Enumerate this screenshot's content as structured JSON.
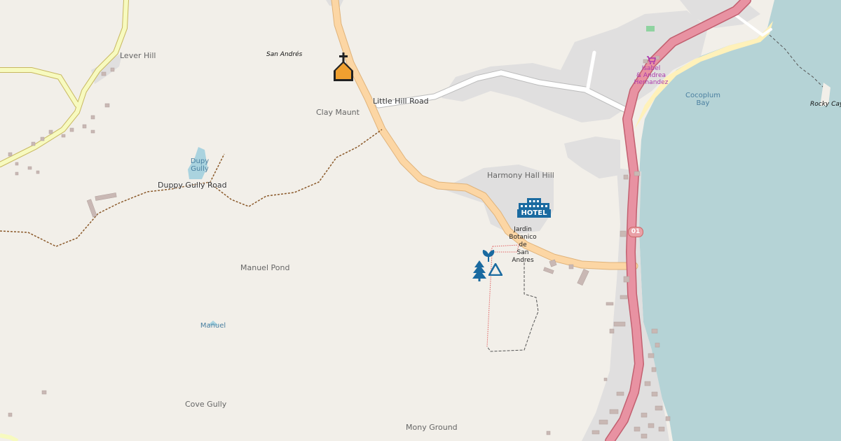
{
  "colors": {
    "land": "#f2efe9",
    "sea": "#aad3df",
    "sea_bay": "#b5d0d0",
    "residential": "#e0dfdf",
    "primary_road": "#e892a2",
    "secondary_road": "#fcd6a4",
    "tertiary_road": "#f7fabf",
    "minor_road": "#ffffff",
    "path": "#8b5a2b",
    "building": "#c9b8b4",
    "beach": "#fff1ba",
    "poi_blue": "#1a6aa0",
    "church": "#f0a030"
  },
  "places": {
    "lever_hill": "Lever Hill",
    "san_andres": "San Andrés",
    "clay_maunt": "Clay Maunt",
    "harmony_hall_hill": "Harmony Hall Hill",
    "manuel_pond": "Manuel Pond",
    "cove_gully": "Cove Gully",
    "mony_ground": "Mony Ground",
    "rocky_cay": "Rocky Cay"
  },
  "water": {
    "dupy_gully_1": "Dupy",
    "dupy_gully_2": "Gully",
    "manuel": "Manuel",
    "cocoplum_bay_1": "Cocoplum",
    "cocoplum_bay_2": "Bay"
  },
  "roads": {
    "little_hill_road": "Little Hill Road",
    "duppy_gully_road": "Duppy Gully Road",
    "route_ref": "01"
  },
  "pois": {
    "garden_line1": "Jardin",
    "garden_line2": "Botanico",
    "garden_line3": "de",
    "garden_line4": "San",
    "garden_line5": "Andres",
    "hotel_sign": "HOTEL",
    "shop_line1": "Isabel",
    "shop_line2": "& Andrea",
    "shop_line3": "Hernandez"
  },
  "icons": [
    "church-icon",
    "hotel-icon",
    "garden-icon",
    "tree-icon",
    "viewpoint-icon",
    "shop-icon"
  ]
}
